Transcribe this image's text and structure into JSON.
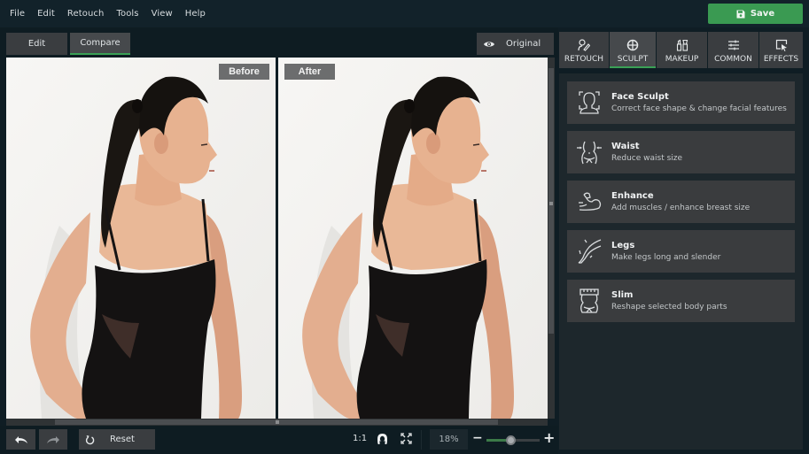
{
  "menu": [
    "File",
    "Edit",
    "Retouch",
    "Tools",
    "View",
    "Help"
  ],
  "save_button": {
    "label": "Save",
    "icon": "floppy-disk-icon",
    "color": "#3a9a52"
  },
  "mode_tabs": [
    {
      "label": "Edit",
      "active": false
    },
    {
      "label": "Compare",
      "active": true
    }
  ],
  "original_button": {
    "label": "Original",
    "icon": "eye-icon"
  },
  "compare": {
    "before_label": "Before",
    "after_label": "After"
  },
  "bottom_toolbar": {
    "undo_icon": "undo-icon",
    "redo_icon": "redo-icon",
    "reset_label": "Reset",
    "ratio_label": "1:1",
    "face_icon": "face-zoom-icon",
    "fit_icon": "fit-screen-icon",
    "zoom_value": "18%",
    "zoom_slider_fraction": 0.45,
    "minus_label": "−",
    "plus_label": "+"
  },
  "right_tabs": [
    {
      "label": "RETOUCH",
      "icon": "retouch-icon",
      "active": false
    },
    {
      "label": "SCULPT",
      "icon": "sculpt-icon",
      "active": true
    },
    {
      "label": "MAKEUP",
      "icon": "makeup-icon",
      "active": false
    },
    {
      "label": "COMMON",
      "icon": "sliders-icon",
      "active": false
    },
    {
      "label": "EFFECTS",
      "icon": "effects-icon",
      "active": false
    }
  ],
  "sculpt_tools": [
    {
      "title": "Face Sculpt",
      "desc": "Correct face shape & change facial features",
      "icon": "face-sculpt-icon"
    },
    {
      "title": "Waist",
      "desc": "Reduce waist size",
      "icon": "waist-icon"
    },
    {
      "title": "Enhance",
      "desc": "Add muscles / enhance breast size",
      "icon": "muscle-icon"
    },
    {
      "title": "Legs",
      "desc": "Make legs long and slender",
      "icon": "legs-icon"
    },
    {
      "title": "Slim",
      "desc": "Reshape selected body parts",
      "icon": "slim-icon"
    }
  ],
  "accent_color": "#3aa156"
}
